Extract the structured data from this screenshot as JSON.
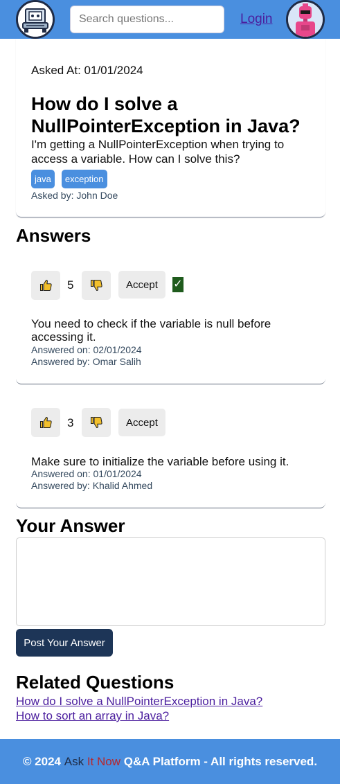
{
  "header": {
    "logo_icon": "robot-laptop-logo-icon",
    "search_placeholder": "Search questions...",
    "login_label": "Login",
    "avatar_icon": "pink-robot-avatar-icon"
  },
  "question": {
    "asked_at": "Asked At: 01/01/2024",
    "title": "How do I solve a NullPointerException in Java?",
    "body": "I'm getting a NullPointerException when trying to access a variable. How can I solve this?",
    "tags": [
      "java",
      "exception"
    ],
    "asked_by": "Asked by: John Doe"
  },
  "answers_title": "Answers",
  "answers": [
    {
      "votes": "5",
      "accept_label": "Accept",
      "accepted": true,
      "accepted_mark": "✓",
      "text": "You need to check if the variable is null before accessing it.",
      "answered_on": "Answered on: 02/01/2024",
      "answered_by": "Answered by: Omar Salih"
    },
    {
      "votes": "3",
      "accept_label": "Accept",
      "accepted": false,
      "text": "Make sure to initialize the variable before using it.",
      "answered_on": "Answered on: 01/01/2024",
      "answered_by": "Answered by: Khalid Ahmed"
    }
  ],
  "your_answer": {
    "title": "Your Answer",
    "value": "",
    "post_label": "Post Your Answer"
  },
  "related": {
    "title": "Related Questions",
    "links": [
      "How do I solve a NullPointerException in Java?",
      "How to sort an array in Java?"
    ]
  },
  "footer": {
    "prefix": "© 2024 ",
    "brand_ask": "Ask",
    "brand_it": "It",
    "brand_now": "Now",
    "suffix": " Q&A Platform - All rights reserved."
  },
  "colors": {
    "header_bg": "#4a8fdf",
    "primary_dark": "#1d3557",
    "tag_bg": "#4a8fdf",
    "accepted": "#1f5b1d",
    "brand_red": "#b8262b"
  }
}
